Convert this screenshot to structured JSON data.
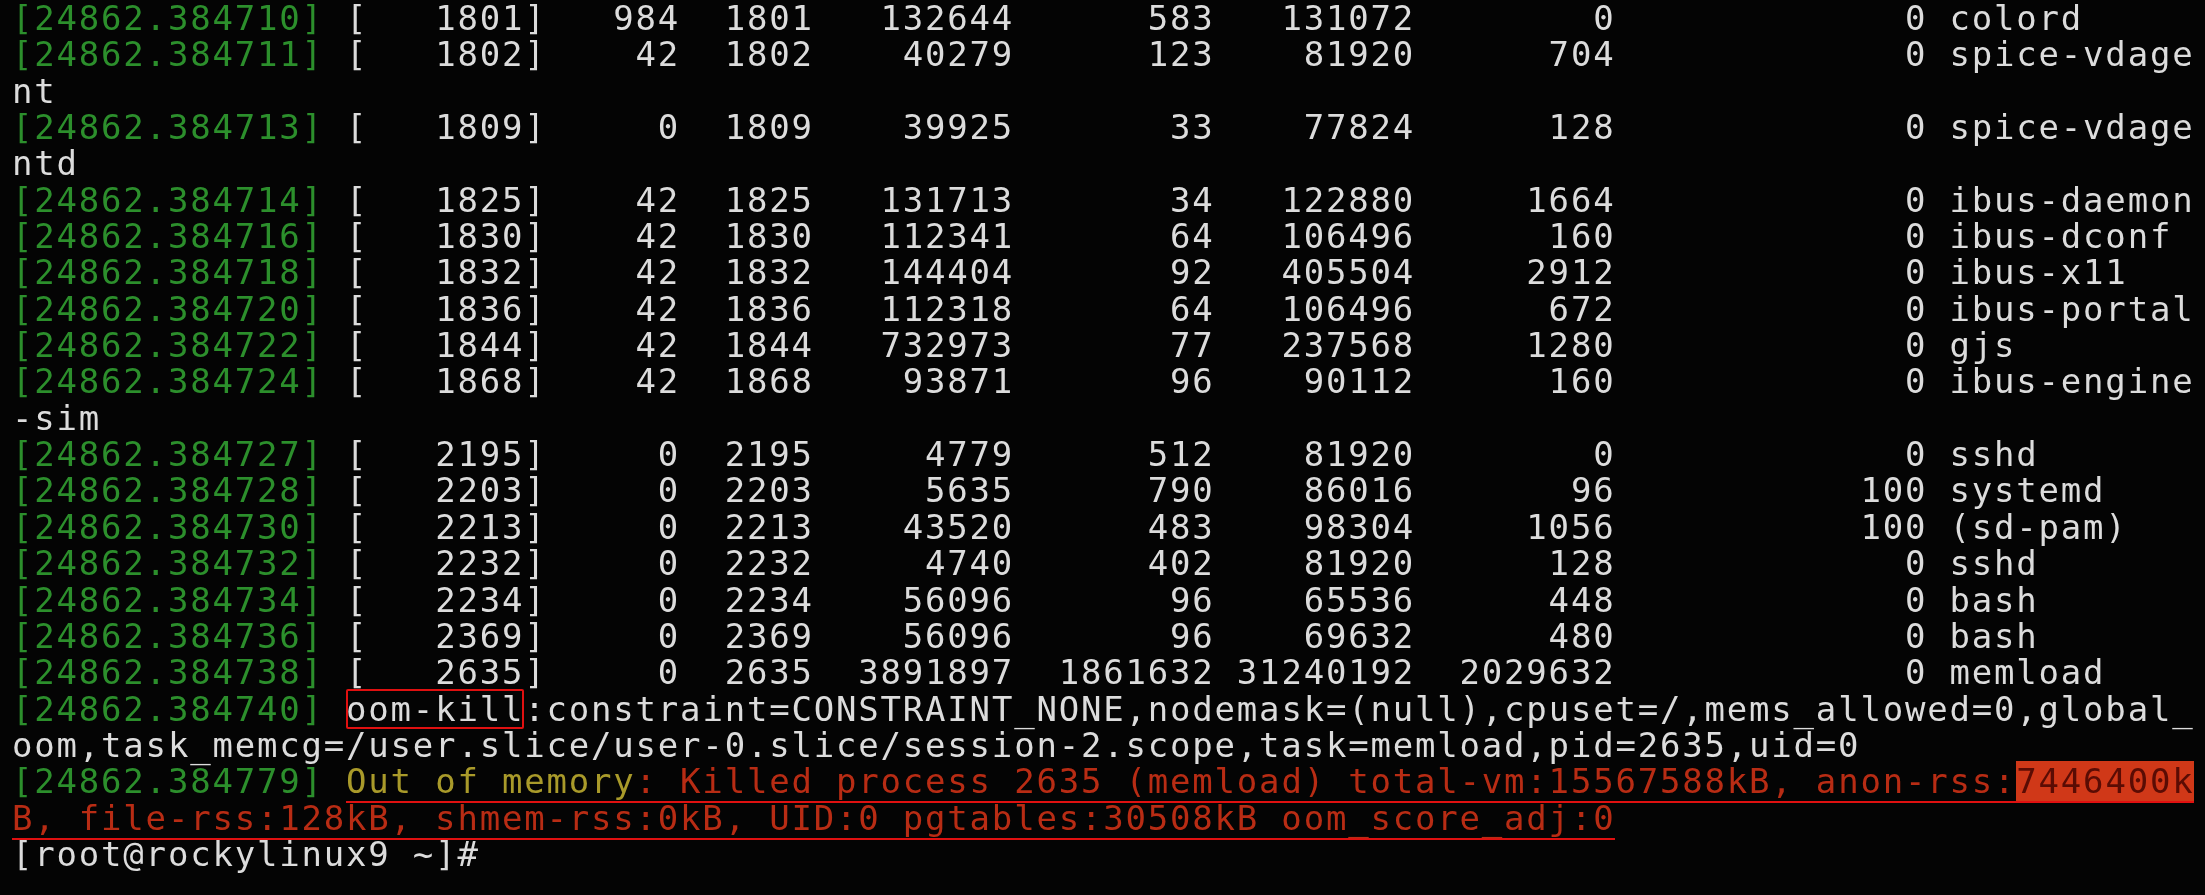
{
  "terminal": {
    "lines": [
      {
        "underlined": false,
        "segments": [
          {
            "kind": "timestamp",
            "text": "[24862.384710]"
          },
          {
            "kind": "plain",
            "text": " [   1801]   984  1801   132644      583   131072        0             0 colord"
          }
        ]
      },
      {
        "underlined": false,
        "segments": [
          {
            "kind": "timestamp",
            "text": "[24862.384711]"
          },
          {
            "kind": "plain",
            "text": " [   1802]    42  1802    40279      123    81920      704             0 spice-vdage"
          }
        ]
      },
      {
        "underlined": false,
        "segments": [
          {
            "kind": "plain",
            "text": "nt"
          }
        ]
      },
      {
        "underlined": false,
        "segments": [
          {
            "kind": "timestamp",
            "text": "[24862.384713]"
          },
          {
            "kind": "plain",
            "text": " [   1809]     0  1809    39925       33    77824      128             0 spice-vdage"
          }
        ]
      },
      {
        "underlined": false,
        "segments": [
          {
            "kind": "plain",
            "text": "ntd"
          }
        ]
      },
      {
        "underlined": false,
        "segments": [
          {
            "kind": "timestamp",
            "text": "[24862.384714]"
          },
          {
            "kind": "plain",
            "text": " [   1825]    42  1825   131713       34   122880     1664             0 ibus-daemon"
          }
        ]
      },
      {
        "underlined": false,
        "segments": [
          {
            "kind": "timestamp",
            "text": "[24862.384716]"
          },
          {
            "kind": "plain",
            "text": " [   1830]    42  1830   112341       64   106496      160             0 ibus-dconf"
          }
        ]
      },
      {
        "underlined": false,
        "segments": [
          {
            "kind": "timestamp",
            "text": "[24862.384718]"
          },
          {
            "kind": "plain",
            "text": " [   1832]    42  1832   144404       92   405504     2912             0 ibus-x11"
          }
        ]
      },
      {
        "underlined": false,
        "segments": [
          {
            "kind": "timestamp",
            "text": "[24862.384720]"
          },
          {
            "kind": "plain",
            "text": " [   1836]    42  1836   112318       64   106496      672             0 ibus-portal"
          }
        ]
      },
      {
        "underlined": false,
        "segments": [
          {
            "kind": "timestamp",
            "text": "[24862.384722]"
          },
          {
            "kind": "plain",
            "text": " [   1844]    42  1844   732973       77   237568     1280             0 gjs"
          }
        ]
      },
      {
        "underlined": false,
        "segments": [
          {
            "kind": "timestamp",
            "text": "[24862.384724]"
          },
          {
            "kind": "plain",
            "text": " [   1868]    42  1868    93871       96    90112      160             0 ibus-engine"
          }
        ]
      },
      {
        "underlined": false,
        "segments": [
          {
            "kind": "plain",
            "text": "-sim"
          }
        ]
      },
      {
        "underlined": false,
        "segments": [
          {
            "kind": "timestamp",
            "text": "[24862.384727]"
          },
          {
            "kind": "plain",
            "text": " [   2195]     0  2195     4779      512    81920        0             0 sshd"
          }
        ]
      },
      {
        "underlined": false,
        "segments": [
          {
            "kind": "timestamp",
            "text": "[24862.384728]"
          },
          {
            "kind": "plain",
            "text": " [   2203]     0  2203     5635      790    86016       96           100 systemd"
          }
        ]
      },
      {
        "underlined": false,
        "segments": [
          {
            "kind": "timestamp",
            "text": "[24862.384730]"
          },
          {
            "kind": "plain",
            "text": " [   2213]     0  2213    43520      483    98304     1056           100 (sd-pam)"
          }
        ]
      },
      {
        "underlined": false,
        "segments": [
          {
            "kind": "timestamp",
            "text": "[24862.384732]"
          },
          {
            "kind": "plain",
            "text": " [   2232]     0  2232     4740      402    81920      128             0 sshd"
          }
        ]
      },
      {
        "underlined": false,
        "segments": [
          {
            "kind": "timestamp",
            "text": "[24862.384734]"
          },
          {
            "kind": "plain",
            "text": " [   2234]     0  2234    56096       96    65536      448             0 bash"
          }
        ]
      },
      {
        "underlined": false,
        "segments": [
          {
            "kind": "timestamp",
            "text": "[24862.384736]"
          },
          {
            "kind": "plain",
            "text": " [   2369]     0  2369    56096       96    69632      480             0 bash"
          }
        ]
      },
      {
        "underlined": false,
        "segments": [
          {
            "kind": "timestamp",
            "text": "[24862.384738]"
          },
          {
            "kind": "plain",
            "text": " [   2635]     0  2635  3891897  1861632 31240192  2029632             0 memload"
          }
        ]
      },
      {
        "underlined": false,
        "segments": [
          {
            "kind": "timestamp",
            "text": "[24862.384740] "
          },
          {
            "kind": "boxed",
            "text": "oom-kill"
          },
          {
            "kind": "plain",
            "text": ":constraint=CONSTRAINT_NONE,nodemask=(null),cpuset=/,mems_allowed=0,global_"
          }
        ]
      },
      {
        "underlined": false,
        "segments": [
          {
            "kind": "plain",
            "text": "oom,task_memcg=/user.slice/user-0.slice/session-2.scope,task=memload,pid=2635,uid=0"
          }
        ]
      },
      {
        "underlined": true,
        "segments": [
          {
            "kind": "timestamp",
            "text": "[24862.384779] "
          },
          {
            "kind": "warning",
            "text": "Out of memory"
          },
          {
            "kind": "error",
            "text": ": Killed process 2635 (memload) total-vm:15567588kB, anon-rss:"
          },
          {
            "kind": "highlight",
            "text": "7446400k"
          }
        ]
      },
      {
        "underlined": true,
        "segments": [
          {
            "kind": "error",
            "text": "B, file-rss:128kB, shmem-rss:0kB, UID:0 pgtables:30508kB oom_score_adj:0"
          }
        ]
      },
      {
        "underlined": false,
        "segments": [
          {
            "kind": "prompt",
            "text": "[root@rockylinux9 ~]#"
          }
        ]
      }
    ]
  }
}
